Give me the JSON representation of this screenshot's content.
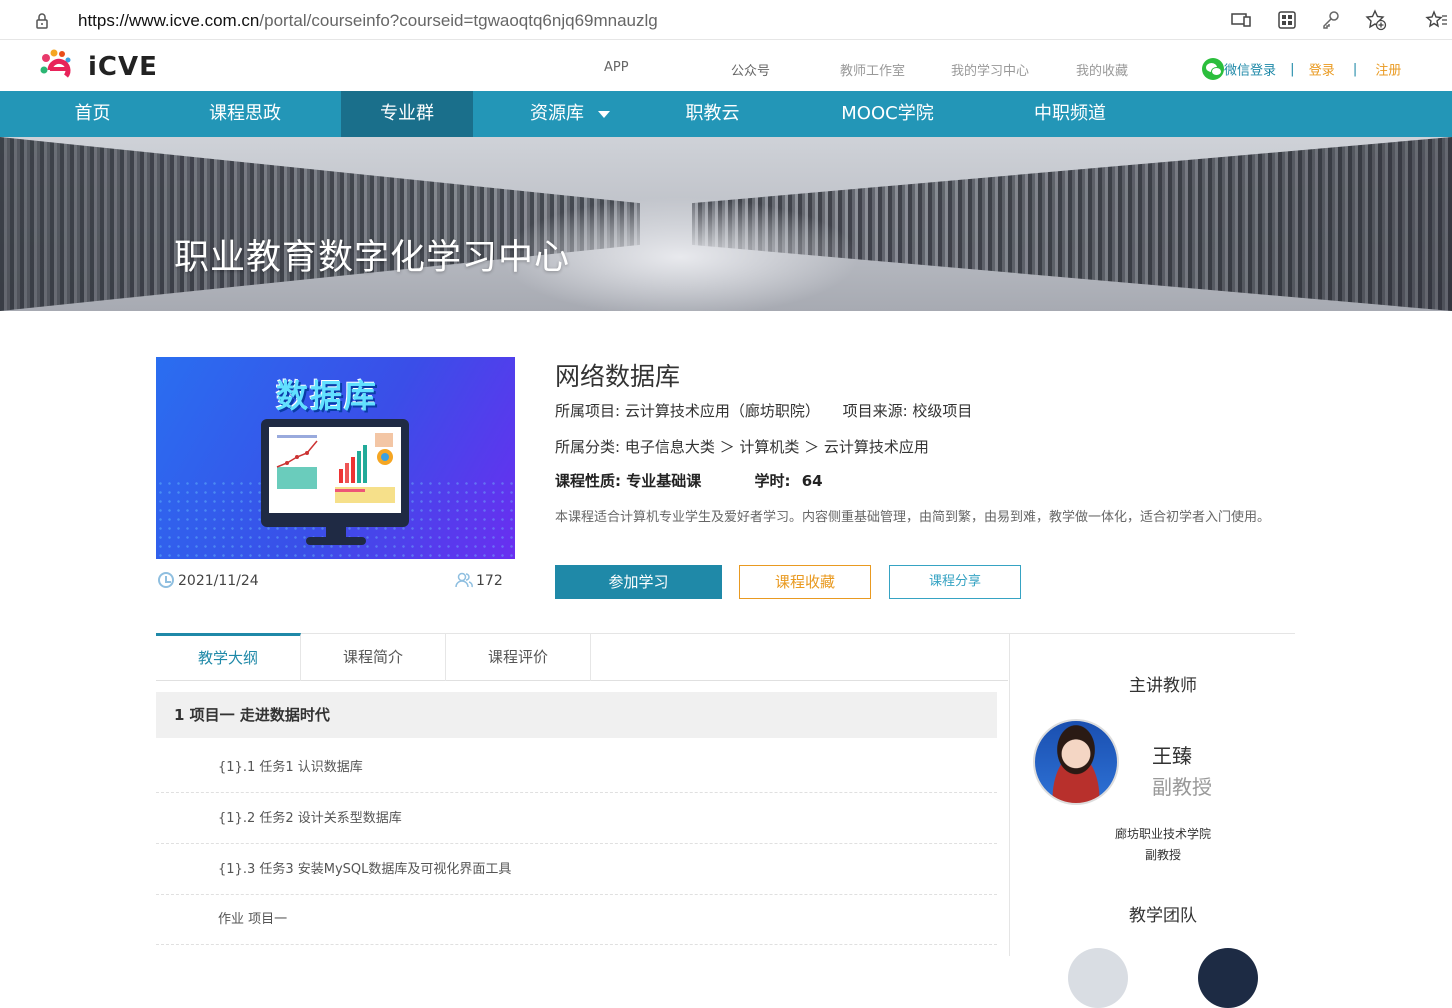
{
  "browser": {
    "url_host": "https://www.icve.com.cn",
    "url_path": "/portal/courseinfo?courseid=tgwaoqtq6njq69mnauzlg"
  },
  "header": {
    "logo_text": "iCVE",
    "links": [
      "APP",
      "公众号",
      "教师工作室",
      "我的学习中心",
      "我的收藏"
    ],
    "wechat_login": "微信登录",
    "login": "登录",
    "register": "注册",
    "separator": "|"
  },
  "nav": {
    "items": [
      "首页",
      "课程思政",
      "专业群",
      "资源库",
      "职教云",
      "MOOC学院",
      "中职频道"
    ],
    "active_index": 2
  },
  "banner": {
    "title": "职业教育数字化学习中心"
  },
  "course": {
    "cover_title": "数据库",
    "date": "2021/11/24",
    "learners": "172",
    "title": "网络数据库",
    "project_label": "所属项目: 云计算技术应用（廊坊职院）",
    "source_label": "项目来源: 校级项目",
    "category_label": "所属分类: 电子信息大类 ＞ 计算机类 ＞ 云计算技术应用",
    "nature_label": "课程性质: 专业基础课",
    "hours_label": "学时:",
    "hours_value": "64",
    "description": "本课程适合计算机专业学生及爱好者学习。内容侧重基础管理，由简到繁，由易到难，教学做一体化，适合初学者入门使用。",
    "join_button": "参加学习",
    "favorite_button": "课程收藏",
    "share_button": "课程分享"
  },
  "tabs": [
    "教学大纲",
    "课程简介",
    "课程评价"
  ],
  "syllabus": {
    "chapter": "1 项目一 走进数据时代",
    "lessons": [
      "{1}.1  任务1 认识数据库",
      "{1}.2  任务2 设计关系型数据库",
      "{1}.3  任务3 安装MySQL数据库及可视化界面工具",
      "作业  项目一"
    ]
  },
  "sidebar": {
    "teacher_heading": "主讲教师",
    "teacher_name": "王臻",
    "teacher_title": "副教授",
    "teacher_org": "廊坊职业技术学院",
    "teacher_org_title": "副教授",
    "team_heading": "教学团队"
  },
  "colors": {
    "nav_bg": "#2396b7",
    "nav_active": "#1a6f8b",
    "primary": "#1f89a8",
    "orange": "#e99a21"
  }
}
